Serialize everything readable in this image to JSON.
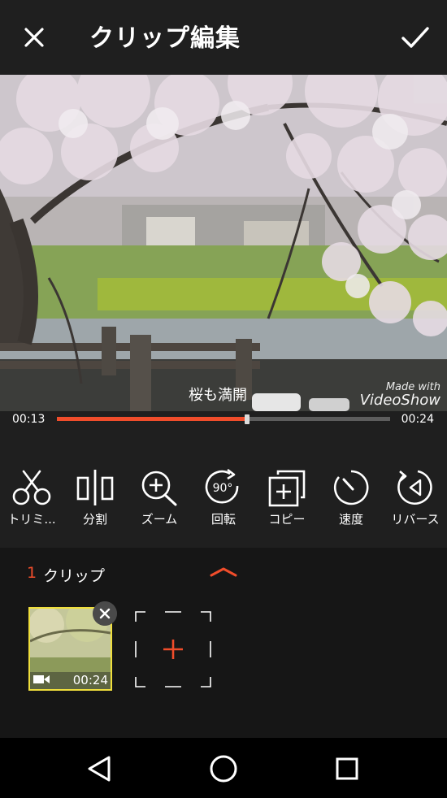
{
  "header": {
    "title": "クリップ編集"
  },
  "preview": {
    "caption": "桜も満開",
    "watermark_line1": "Made with",
    "watermark_line2": "VideoShow"
  },
  "timeline": {
    "current": "00:13",
    "total": "00:24",
    "progress": 0.57
  },
  "tools": [
    {
      "label": "トリミ..."
    },
    {
      "label": "分割"
    },
    {
      "label": "ズーム"
    },
    {
      "label": "回転",
      "badge": "90°"
    },
    {
      "label": "コピー"
    },
    {
      "label": "速度"
    },
    {
      "label": "リバース"
    }
  ],
  "clips": {
    "count": "1",
    "label": "クリップ",
    "items": [
      {
        "duration": "00:24"
      }
    ]
  },
  "colors": {
    "accent": "#f04d2b",
    "selection": "#f0df3c",
    "background": "#1f1f1f"
  }
}
